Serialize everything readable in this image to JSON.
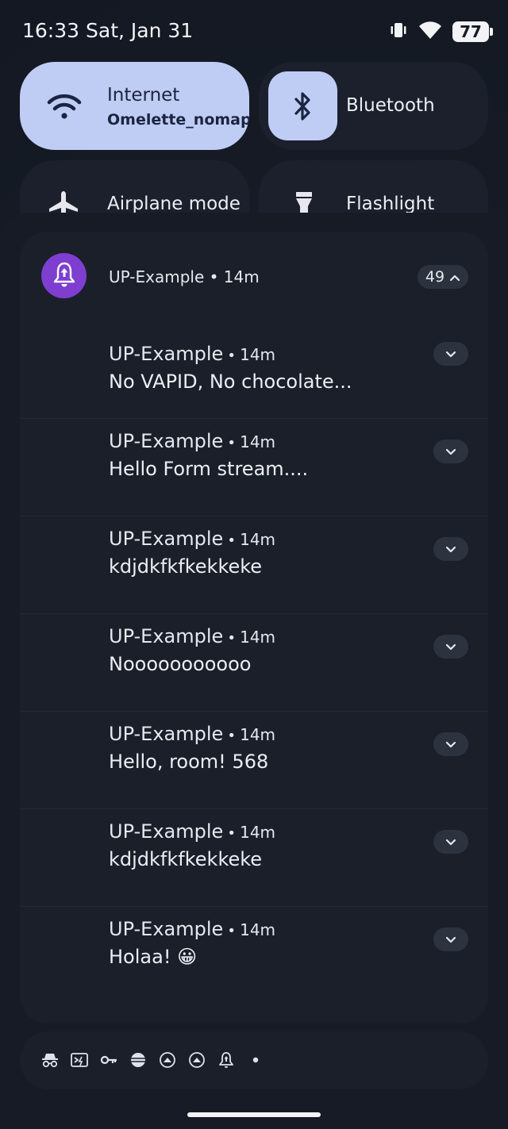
{
  "status_bar": {
    "time": "16:33",
    "date": "Sat, Jan 31",
    "battery_level": "77",
    "icons": [
      "vibrate-icon",
      "wifi-icon",
      "battery-icon"
    ]
  },
  "quick_settings": {
    "internet": {
      "label": "Internet",
      "subtitle": "Omelette_nomap",
      "icon": "wifi-icon",
      "active": true
    },
    "bluetooth": {
      "label": "Bluetooth",
      "icon": "bluetooth-icon",
      "active": false
    },
    "airplane": {
      "label": "Airplane mode",
      "icon": "airplane-icon",
      "active": false
    },
    "flashlight": {
      "label": "Flashlight",
      "icon": "flashlight-icon",
      "active": false
    }
  },
  "notification_group": {
    "app_name": "UP-Example",
    "separator": "•",
    "time": "14m",
    "count": "49",
    "app_icon": "bell-icon",
    "accent_color": "#7e3ed0",
    "notifications": [
      {
        "app": "UP-Example",
        "time": "14m",
        "text": "No VAPID, No chocolate..."
      },
      {
        "app": "UP-Example",
        "time": "14m",
        "text": "Hello Form stream...."
      },
      {
        "app": "UP-Example",
        "time": "14m",
        "text": "kdjdkfkfkekkeke"
      },
      {
        "app": "UP-Example",
        "time": "14m",
        "text": "Nooooooooooo"
      },
      {
        "app": "UP-Example",
        "time": "14m",
        "text": "Hello, room! 568"
      },
      {
        "app": "UP-Example",
        "time": "14m",
        "text": "kdjdkfkfkekkeke"
      },
      {
        "app": "UP-Example",
        "time": "14m",
        "text": "Holaa! 😀"
      }
    ]
  },
  "bottom_icons": [
    "incognito-icon",
    "terminal-icon",
    "key-icon",
    "vpn-icon",
    "upload-circle-icon",
    "upload-circle-icon",
    "bell-icon",
    "more-dot-icon"
  ]
}
